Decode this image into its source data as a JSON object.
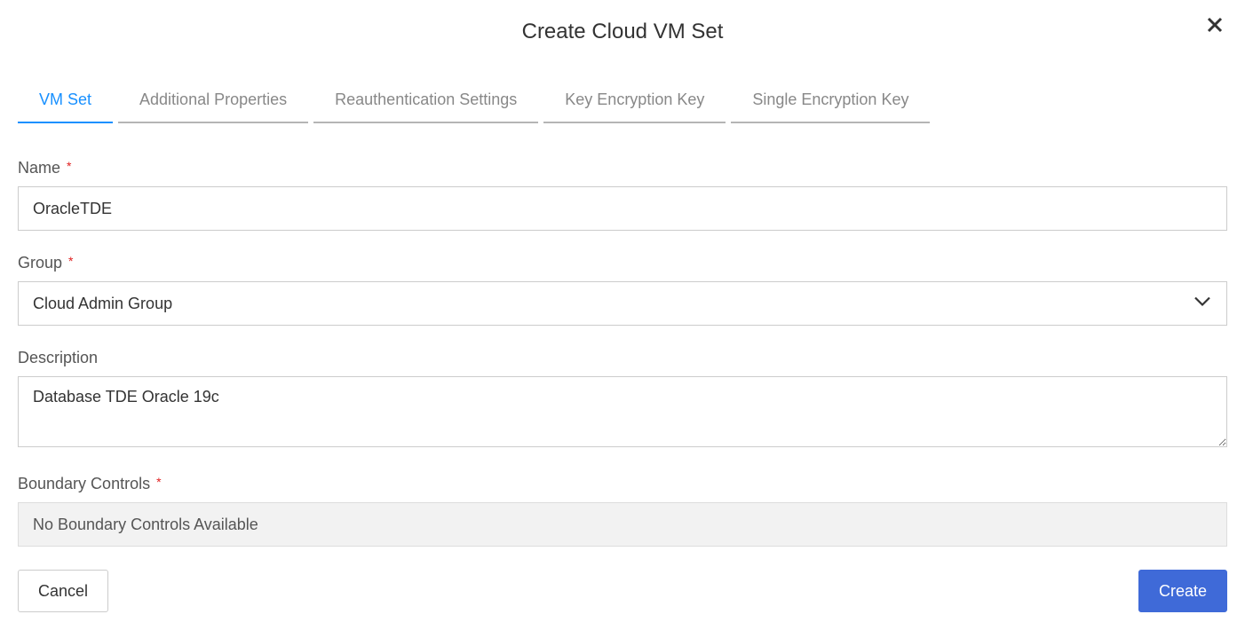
{
  "header": {
    "title": "Create Cloud VM Set"
  },
  "tabs": [
    {
      "label": "VM Set",
      "active": true
    },
    {
      "label": "Additional Properties",
      "active": false
    },
    {
      "label": "Reauthentication Settings",
      "active": false
    },
    {
      "label": "Key Encryption Key",
      "active": false
    },
    {
      "label": "Single Encryption Key",
      "active": false
    }
  ],
  "form": {
    "name": {
      "label": "Name",
      "value": "OracleTDE",
      "required": true
    },
    "group": {
      "label": "Group",
      "value": "Cloud Admin Group",
      "required": true
    },
    "description": {
      "label": "Description",
      "value": "Database TDE Oracle 19c",
      "required": false
    },
    "boundary": {
      "label": "Boundary Controls",
      "value": "No Boundary Controls Available",
      "required": true
    }
  },
  "footer": {
    "cancel": "Cancel",
    "create": "Create"
  },
  "required_mark": "*"
}
